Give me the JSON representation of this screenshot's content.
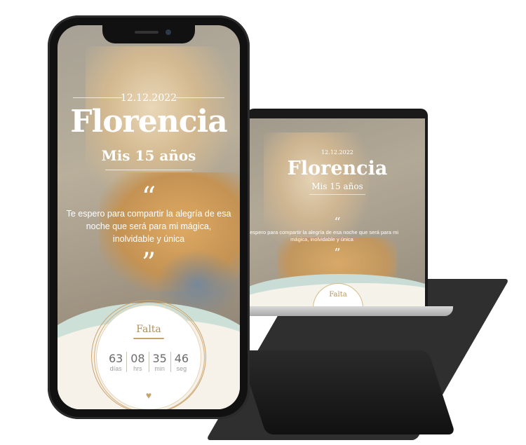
{
  "invitation": {
    "date": "12.12.2022",
    "name": "Florencia",
    "subtitle": "Mis 15 años",
    "open_quote": "“",
    "close_quote": "”",
    "message": "Te espero para compartir la alegría de esa noche que será para mi mágica, inolvidable y única",
    "countdown": {
      "title": "Falta",
      "units": [
        {
          "value": "63",
          "label": "días"
        },
        {
          "value": "08",
          "label": "hrs"
        },
        {
          "value": "35",
          "label": "min"
        },
        {
          "value": "46",
          "label": "seg"
        }
      ]
    }
  },
  "laptop": {
    "date": "12.12.2022",
    "name": "Florencia",
    "subtitle": "Mis 15 años",
    "message": "e espero para compartir la alegría de esa noche que será para mi mágica, inolvidable y única",
    "countdown_title": "Falta"
  },
  "icons": [
    "heart-icon",
    "quote-open-icon",
    "quote-close-icon"
  ],
  "colors": {
    "accent_gold": "#c9a36c",
    "mint": "#cde0d8",
    "cream": "#f6f2e9"
  }
}
